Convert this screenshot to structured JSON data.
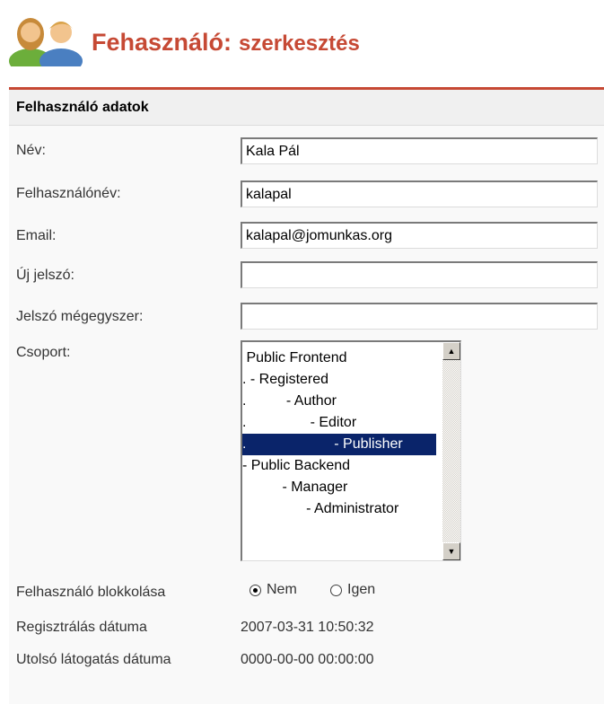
{
  "header": {
    "title": "Fehasználó:",
    "subtitle": "szerkesztés"
  },
  "section": {
    "title": "Felhasználó adatok"
  },
  "fields": {
    "name": {
      "label": "Név:",
      "value": "Kala Pál"
    },
    "username": {
      "label": "Felhasználónév:",
      "value": "kalapal"
    },
    "email": {
      "label": "Email:",
      "value": "kalapal@jomunkas.org"
    },
    "new_password": {
      "label": "Új jelszó:",
      "value": ""
    },
    "password_again": {
      "label": "Jelszó mégegyszer:",
      "value": ""
    }
  },
  "group": {
    "label": "Csoport:",
    "options": [
      " Public Frontend",
      ". - Registered",
      ".          - Author",
      ".                - Editor",
      ".                      - Publisher",
      "- Public Backend",
      "          - Manager",
      "                - Administrator"
    ],
    "selected_index": 4
  },
  "block": {
    "label": "Felhasználó blokkolása",
    "options": [
      "Nem",
      "Igen"
    ],
    "selected": "Nem"
  },
  "registered": {
    "label": "Regisztrálás dátuma",
    "value": "2007-03-31 10:50:32"
  },
  "last_visit": {
    "label": "Utolsó látogatás dátuma",
    "value": "0000-00-00 00:00:00"
  }
}
